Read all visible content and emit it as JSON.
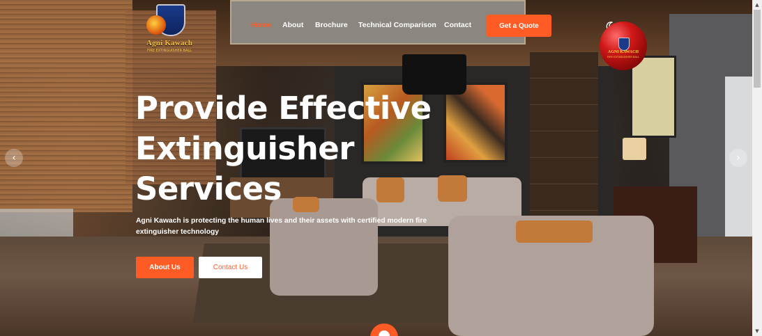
{
  "brand": {
    "name": "Agni Kawach",
    "tagline": "FIRE EXTINGUISHER BALL"
  },
  "nav": {
    "items": [
      {
        "label": "Home",
        "active": true
      },
      {
        "label": "About",
        "active": false
      },
      {
        "label": "Brochure",
        "active": false
      },
      {
        "label": "Technical Comparison",
        "active": false
      },
      {
        "label": "Contact",
        "active": false
      }
    ],
    "cta_label": "Get a Quote",
    "theme_icon": "moon-icon"
  },
  "hero": {
    "headline_lines": [
      "Provide Effective",
      "Extinguisher",
      "Services"
    ],
    "description": "Agni Kawach is protecting the human lives and their assets with certified modern fire extinguisher technology",
    "primary_button": "About Us",
    "secondary_button": "Contact Us",
    "ball_label": "AGNI KAWACH",
    "ball_sub": "FIRE EXTINGUISHER BALL"
  },
  "carousel": {
    "prev_icon": "‹",
    "next_icon": "›"
  },
  "colors": {
    "accent": "#fe5c24",
    "text": "#ffffff"
  }
}
